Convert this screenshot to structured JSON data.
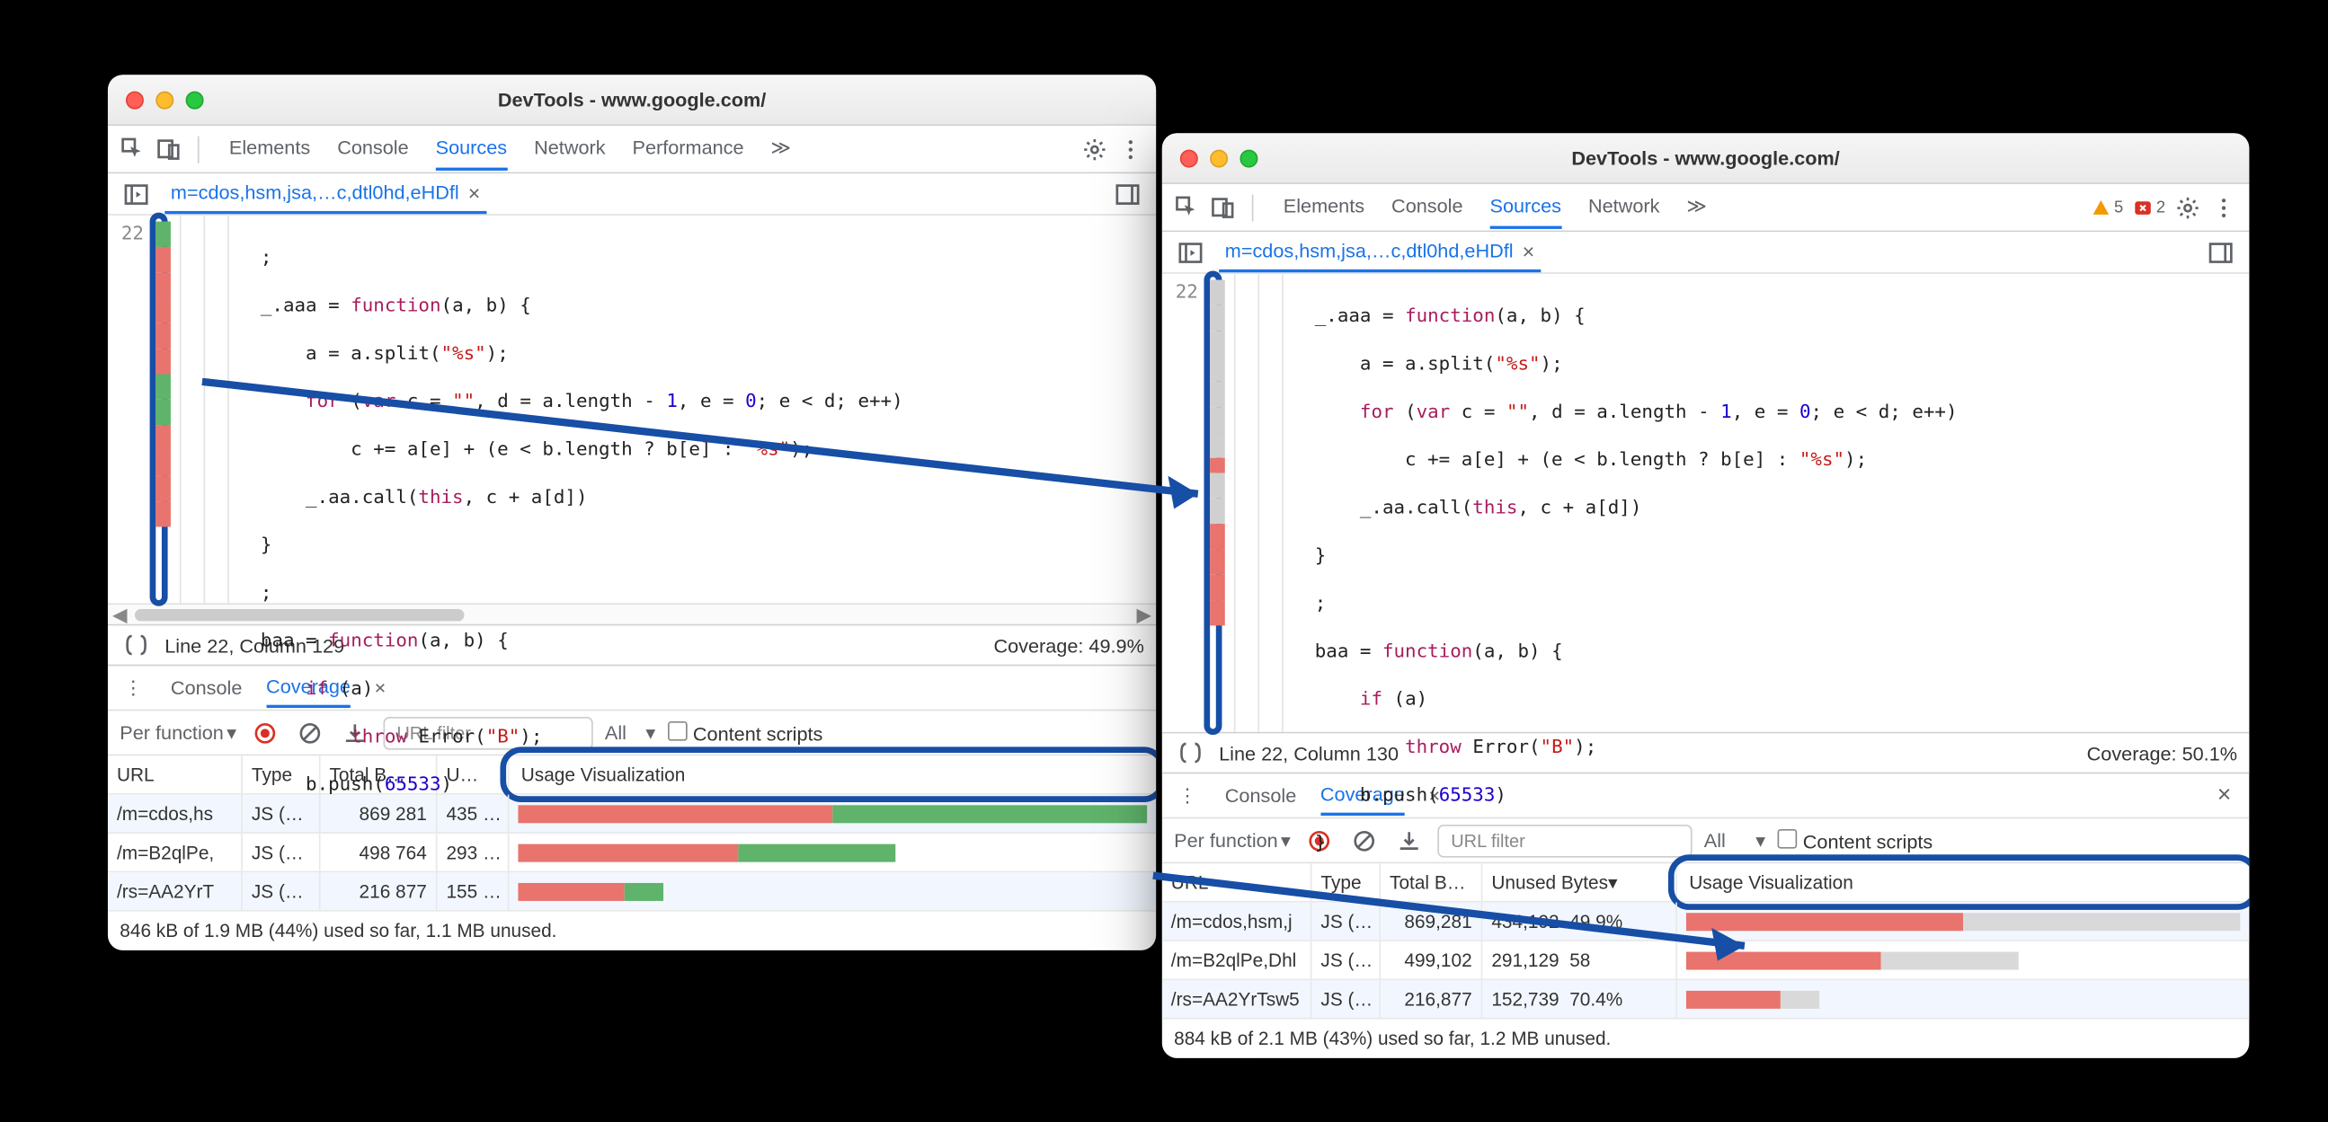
{
  "win1": {
    "title": "DevTools - www.google.com/",
    "panel_tabs": [
      "Elements",
      "Console",
      "Sources",
      "Network",
      "Performance"
    ],
    "active_panel": "Sources",
    "more": "≫",
    "file_tab": "m=cdos,hsm,jsa,…c,dtl0hd,eHDfl",
    "line_number": "22",
    "code": [
      "        ;",
      "        _.aaa = function(a, b) {",
      "            a = a.split(\"%s\");",
      "            for (var c = \"\", d = a.length - 1, e = 0; e < d; e++)",
      "                c += a[e] + (e < b.length ? b[e] : \"%s\");",
      "            _.aa.call(this, c + a[d])",
      "        }",
      "        ;",
      "        baa = function(a, b) {",
      "            if (a)",
      "                throw Error(\"B\");",
      "            b.push(65533)"
    ],
    "status_line": "Line 22, Column 129",
    "status_cov": "Coverage: 49.9%",
    "drawer_tabs": [
      "Console",
      "Coverage"
    ],
    "drawer_active": "Coverage",
    "cov_filter": "Per function",
    "url_placeholder": "URL filter",
    "type_filter": "All",
    "content_scripts": "Content scripts",
    "cov_cols1": {
      "url": "URL",
      "type": "Type",
      "total": "Total B…",
      "unused": "U…",
      "usage": "Usage Visualization"
    },
    "rows1": [
      {
        "url": "/m=cdos,hs",
        "type": "JS (…",
        "total": "869 281",
        "unused": "435 …",
        "r": 0.5,
        "g": 0.5,
        "gr": 0,
        "fill": 1.0
      },
      {
        "url": "/m=B2qlPe,",
        "type": "JS (…",
        "total": "498 764",
        "unused": "293 …",
        "r": 0.35,
        "g": 0.25,
        "gr": 0,
        "fill": 1.0
      },
      {
        "url": "/rs=AA2YrT",
        "type": "JS (…",
        "total": "216 877",
        "unused": "155 …",
        "r": 0.17,
        "g": 0.06,
        "gr": 0,
        "fill": 1.0
      }
    ],
    "footer1": "846 kB of 1.9 MB (44%) used so far, 1.1 MB unused."
  },
  "win2": {
    "title": "DevTools - www.google.com/",
    "panel_tabs": [
      "Elements",
      "Console",
      "Sources",
      "Network"
    ],
    "active_panel": "Sources",
    "more": "≫",
    "warn_count": "5",
    "err_count": "2",
    "file_tab": "m=cdos,hsm,jsa,…c,dtl0hd,eHDfl",
    "line_number": "22",
    "code": [
      "_.aaa = function(a, b) {",
      "    a = a.split(\"%s\");",
      "    for (var c = \"\", d = a.length - 1, e = 0; e < d; e++)",
      "        c += a[e] + (e < b.length ? b[e] : \"%s\");",
      "    _.aa.call(this, c + a[d])",
      "}",
      ";",
      "baa = function(a, b) {",
      "    if (a)",
      "        throw Error(\"B\");",
      "    b.push(65533)",
      "}"
    ],
    "status_line": "Line 22, Column 130",
    "status_cov": "Coverage: 50.1%",
    "drawer_tabs": [
      "Console",
      "Coverage"
    ],
    "drawer_active": "Coverage",
    "cov_filter": "Per function",
    "url_placeholder": "URL filter",
    "type_filter": "All",
    "content_scripts": "Content scripts",
    "cov_cols2": {
      "url": "URL",
      "type": "Type",
      "total": "Total B…",
      "unused": "Unused Bytes",
      "usage": "Usage Visualization"
    },
    "rows2": [
      {
        "url": "/m=cdos,hsm,j",
        "type": "JS (…",
        "total": "869,281",
        "unused": "434,192",
        "pct": "49.9%",
        "r": 0.5,
        "gr": 0.5,
        "fill": 1.0
      },
      {
        "url": "/m=B2qlPe,Dhl",
        "type": "JS (…",
        "total": "499,102",
        "unused": "291,129",
        "pct": "58",
        "r": 0.35,
        "gr": 0.25,
        "fill": 1.0
      },
      {
        "url": "/rs=AA2YrTsw5",
        "type": "JS (…",
        "total": "216,877",
        "unused": "152,739",
        "pct": "70.4%",
        "r": 0.17,
        "gr": 0.07,
        "fill": 1.0
      }
    ],
    "footer2": "884 kB of 2.1 MB (43%) used so far, 1.2 MB unused."
  }
}
